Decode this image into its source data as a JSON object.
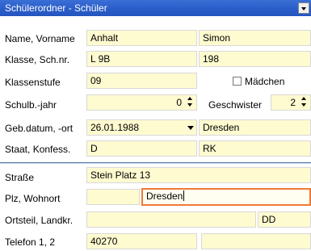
{
  "window": {
    "title": "Schülerordner - Schüler",
    "menu_icon": "chevron-down-icon"
  },
  "rows": {
    "name": {
      "label": "Name, Vorname",
      "last": "Anhalt",
      "first": "Simon"
    },
    "klasse": {
      "label": "Klasse, Sch.nr.",
      "klasse": "L 9B",
      "schnr": "198"
    },
    "stufe": {
      "label": "Klassenstufe",
      "value": "09",
      "maedchen_label": "Mädchen",
      "maedchen_checked": false
    },
    "schuljahr": {
      "label": "Schulb.-jahr",
      "value": "0",
      "geschwister_label": "Geschwister",
      "geschwister_value": "2"
    },
    "geburt": {
      "label": "Geb.datum, -ort",
      "datum": "26.01.1988",
      "ort": "Dresden"
    },
    "staat": {
      "label": "Staat, Konfess.",
      "staat": "D",
      "konfession": "RK"
    },
    "strasse": {
      "label": "Straße",
      "value": "Stein Platz 13"
    },
    "plz": {
      "label": "Plz, Wohnort",
      "plz": "",
      "wohnort": "Dresden"
    },
    "ortsteil": {
      "label": "Ortsteil, Landkr.",
      "ortsteil": "",
      "landkreis": "DD"
    },
    "telefon": {
      "label": "Telefon 1, 2",
      "tel1": "40270",
      "tel2": ""
    }
  }
}
